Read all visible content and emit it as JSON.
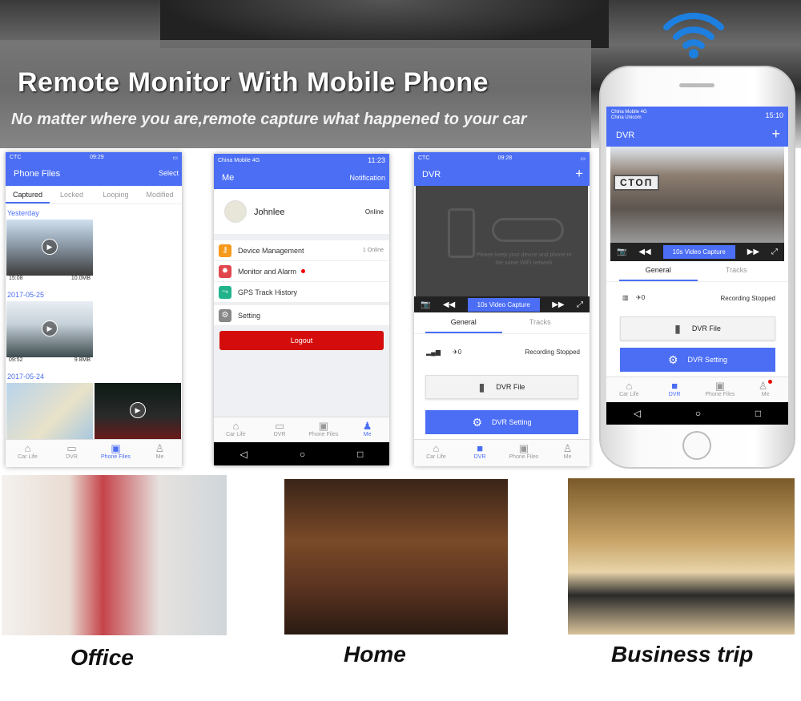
{
  "banner": {
    "title": "Remote Monitor With Mobile Phone",
    "subtitle": "No matter where you are,remote capture what happened to your car",
    "wifi_icon": "wifi-icon"
  },
  "nav": {
    "car_life": "Car Life",
    "dvr": "DVR",
    "phone_files": "Phone Files",
    "me": "Me"
  },
  "screen1": {
    "carrier": "CTC",
    "time": "09:29",
    "title": "Phone Files",
    "action": "Select",
    "tabs": [
      "Captured",
      "Locked",
      "Looping",
      "Modified"
    ],
    "groups": [
      {
        "date": "Yesterday",
        "time": "15:08",
        "size": "10.0MB"
      },
      {
        "date": "2017-05-25",
        "time": "09:52",
        "size": "9.8MB"
      },
      {
        "date": "2017-05-24"
      }
    ]
  },
  "screen2": {
    "carrier": "China Mobile 4G",
    "time": "11:23",
    "title": "Me",
    "action": "Notification",
    "user": "Johnlee",
    "status": "Online",
    "menu": [
      {
        "label": "Device Management",
        "badge": "1 Online",
        "color": "#f59a1b"
      },
      {
        "label": "Monitor and Alarm",
        "color": "#e0474c"
      },
      {
        "label": "GPS Track History",
        "color": "#21b38a"
      },
      {
        "label": "Setting",
        "color": "#888888"
      }
    ],
    "logout": "Logout"
  },
  "screen3": {
    "carrier": "CTC",
    "time": "09:28",
    "title": "DVR",
    "hint": "Please keep your device and phone in the same WiFi network",
    "capture": "10s Video Capture",
    "tabs": [
      "General",
      "Tracks"
    ],
    "satellites": "0",
    "recording": "Recording Stopped",
    "dvr_file": "DVR File",
    "dvr_setting": "DVR Setting"
  },
  "screen4": {
    "carrier": "China Mobile 4G",
    "carrier2": "China Unicom",
    "time": "15:10",
    "title": "DVR",
    "capture": "10s Video Capture",
    "tabs": [
      "General",
      "Tracks"
    ],
    "satellites": "0",
    "recording": "Recording Stopped",
    "dvr_file": "DVR File",
    "dvr_setting": "DVR Setting",
    "sign": "СТОП"
  },
  "scenes": [
    "Office",
    "Home",
    "Business trip"
  ],
  "colors": {
    "accent": "#4b6ef5",
    "logout": "#d50c0c",
    "badge": "#e00000"
  }
}
